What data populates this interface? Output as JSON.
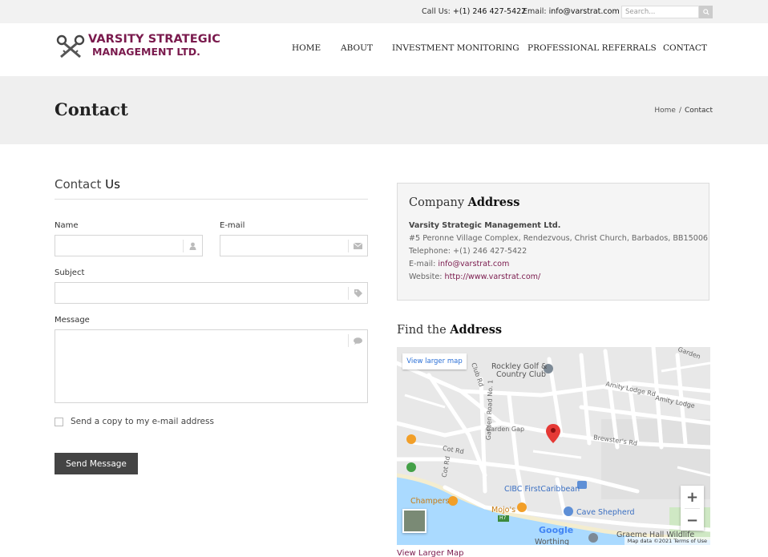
{
  "topbar": {
    "call_label": "Call Us:",
    "call_value": "+(1) 246 427-5422",
    "email_label": "Email:",
    "email_value": "info@varstrat.com",
    "search_placeholder": "Search..."
  },
  "logo": {
    "line1": "VARSITY STRATEGIC",
    "line2": "MANAGEMENT LTD."
  },
  "nav": {
    "items": [
      "HOME",
      "ABOUT",
      "INVESTMENT MONITORING",
      "PROFESSIONAL REFERRALS",
      "CONTACT"
    ]
  },
  "page": {
    "title": "Contact",
    "breadcrumb": [
      "Home",
      "/",
      "Contact"
    ]
  },
  "form": {
    "heading_light": "Contact",
    "heading_bold": "Us",
    "name_label": "Name",
    "email_label": "E-mail",
    "subject_label": "Subject",
    "message_label": "Message",
    "copy_label": "Send a copy to my e-mail address",
    "submit_label": "Send Message"
  },
  "company": {
    "heading_light": "Company",
    "heading_bold": "Address",
    "name": "Varsity Strategic Management Ltd.",
    "address": "#5 Peronne Village Complex, Rendezvous, Christ Church, Barbados, BB15006",
    "telephone_label": "Telephone:",
    "telephone": "+(1) 246 427-5422",
    "email_label": "E-mail:",
    "email": "info@varstrat.com",
    "website_label": "Website:",
    "website": "http://www.varstrat.com/"
  },
  "find": {
    "heading_light": "Find the",
    "heading_bold": "Address"
  },
  "map": {
    "view_larger_button": "View larger map",
    "places": {
      "golf": "Rockley Golf &",
      "golf2": "Country Club",
      "cibc": "CIBC FirstCaribbean",
      "champers": "Champers",
      "mojos": "Mojo's",
      "cave": "Cave Shepherd",
      "graeme": "Graeme Hall Wildlife",
      "worthing": "Worthing"
    },
    "streets": {
      "amity1": "Amity Lodge Rd",
      "amity2": "Amity Lodge",
      "brewster": "Brewster's Rd",
      "garden_gap": "Garden Gap",
      "garden_road": "Garden Road No. 1",
      "cot_rd": "Cot Rd",
      "cot_rd2": "Cot Rd",
      "club_rd": "Club Rd",
      "garden": "Garden",
      "h7": "H7"
    },
    "google_logo": "Google",
    "attribution": "Map data ©2021   Terms of Use",
    "zoom_in": "+",
    "zoom_out": "−"
  },
  "view_larger_link": "View Larger Map",
  "colors": {
    "brand": "#7a1a4d",
    "map_link": "#2a6fd6",
    "button": "#444444"
  }
}
